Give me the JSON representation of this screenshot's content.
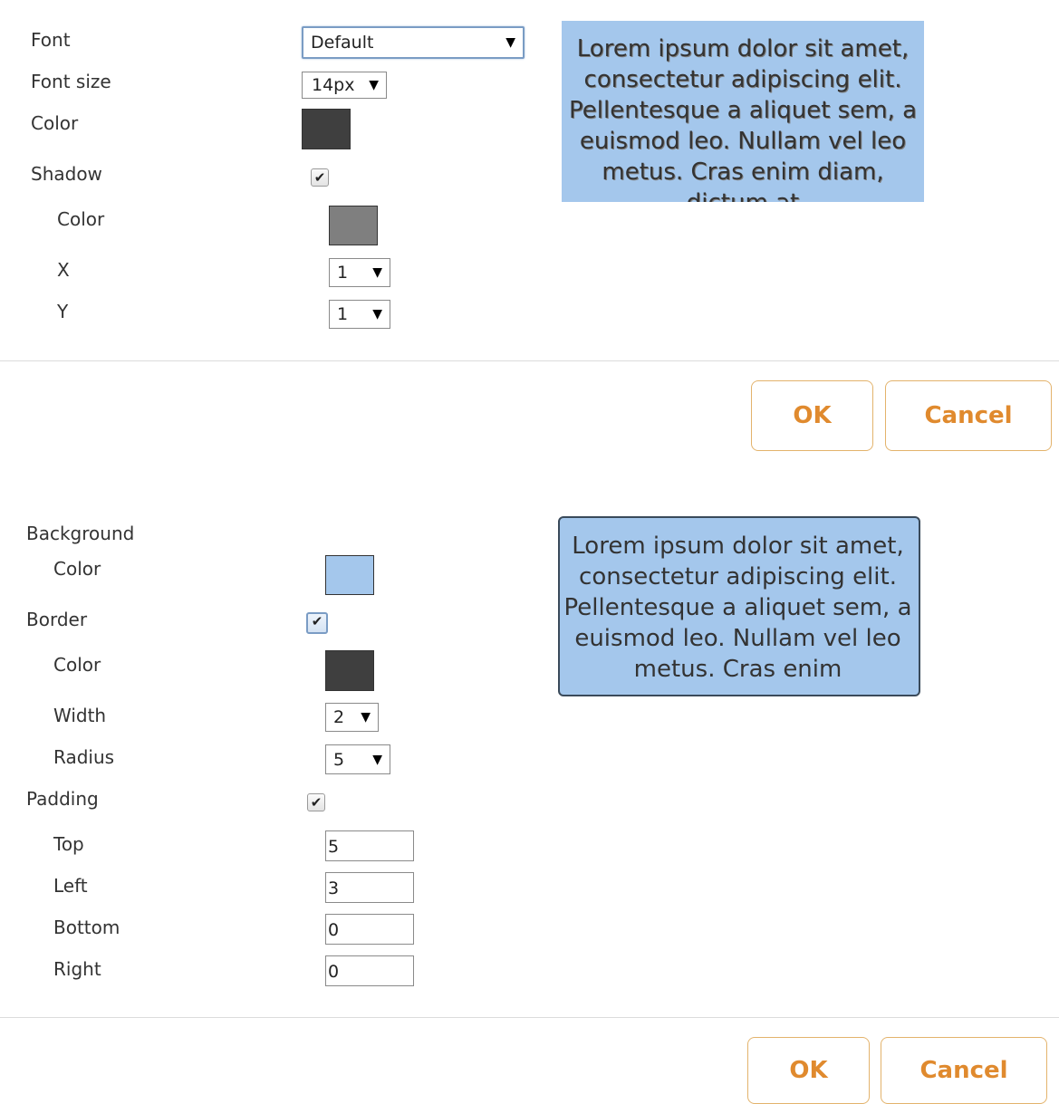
{
  "colors": {
    "accent": "#e08a2e",
    "preview_bg": "#a4c7ec",
    "dark_swatch": "#3f3f3f",
    "shadow_swatch": "#7f7f7f",
    "bg_swatch": "#a4c7ec",
    "border_swatch": "#3f3f3f"
  },
  "font_panel": {
    "font_label": "Font",
    "font_value": "Default",
    "font_size_label": "Font size",
    "font_size_value": "14px",
    "color_label": "Color",
    "shadow_label": "Shadow",
    "shadow_checked": true,
    "shadow_color_label": "Color",
    "x_label": "X",
    "x_value": "1",
    "y_label": "Y",
    "y_value": "1",
    "preview_text": "Lorem ipsum dolor sit amet, consectetur adipiscing elit. Pellentesque a aliquet sem, a euismod leo. Nullam vel leo metus. Cras enim diam, dictum at",
    "ok_label": "OK",
    "cancel_label": "Cancel"
  },
  "box_panel": {
    "background_label": "Background",
    "bg_color_label": "Color",
    "border_label": "Border",
    "border_checked": true,
    "border_color_label": "Color",
    "width_label": "Width",
    "width_value": "2",
    "radius_label": "Radius",
    "radius_value": "5",
    "padding_label": "Padding",
    "padding_checked": true,
    "top_label": "Top",
    "top_value": "5",
    "left_label": "Left",
    "left_value": "3",
    "bottom_label": "Bottom",
    "bottom_value": "0",
    "right_label": "Right",
    "right_value": "0",
    "preview_text": "Lorem ipsum dolor sit amet, consectetur adipiscing elit. Pellentesque a aliquet sem, a euismod leo. Nullam vel leo metus. Cras enim",
    "ok_label": "OK",
    "cancel_label": "Cancel"
  },
  "arrow_glyph": "▼",
  "check_glyph": "✔"
}
